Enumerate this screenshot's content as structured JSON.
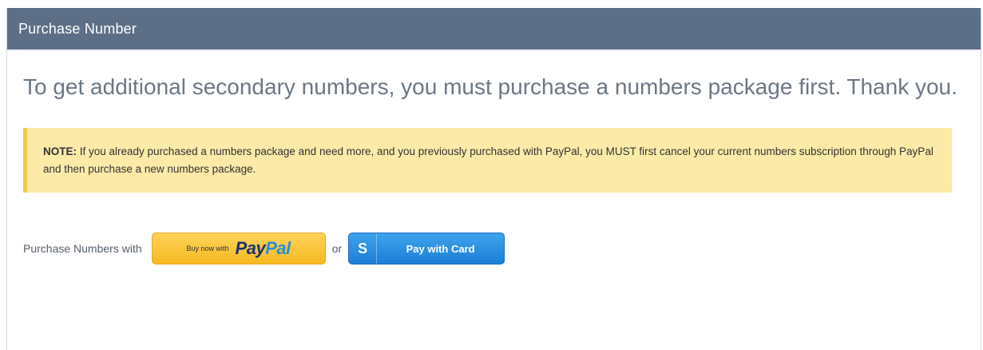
{
  "header": {
    "title": "Purchase Number"
  },
  "main": {
    "lead_text": "To get additional secondary numbers, you must purchase a numbers package first. Thank you.",
    "note": {
      "label": "NOTE:",
      "text": " If you already purchased a numbers package and need more, and you previously purchased with PayPal, you MUST first cancel your current numbers subscription through PayPal and then purchase a new numbers package."
    },
    "purchase": {
      "label": "Purchase Numbers with",
      "paypal_buy_text": "Buy now with",
      "paypal_pay": "Pay",
      "paypal_pal": "Pal",
      "or_text": "or",
      "card_icon_text": "S",
      "card_label": "Pay with Card"
    }
  },
  "colors": {
    "header_bg": "#5d6f87",
    "note_bg": "#fbeaa8",
    "note_border": "#f2c94c",
    "paypal_yellow": "#f5b921",
    "card_blue": "#1c7ed6"
  }
}
